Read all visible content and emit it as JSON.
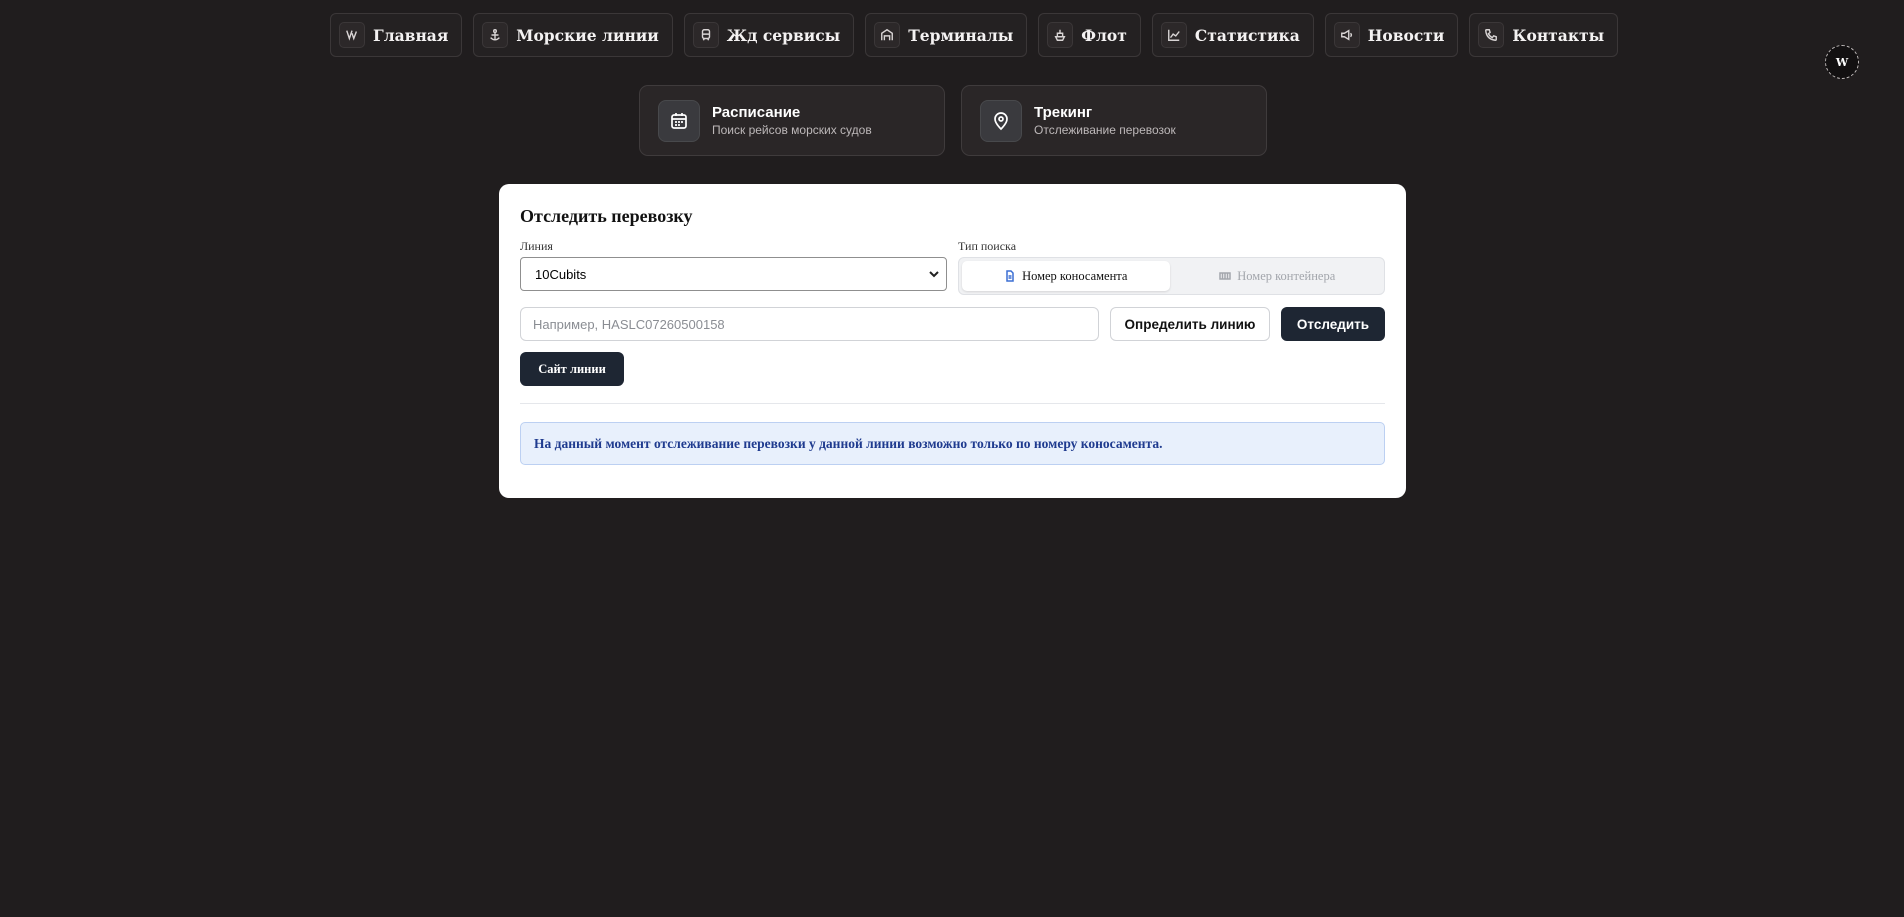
{
  "nav": {
    "items": [
      {
        "label": "Главная",
        "icon": "brand-logo-icon"
      },
      {
        "label": "Морские линии",
        "icon": "anchor-icon"
      },
      {
        "label": "Жд сервисы",
        "icon": "train-icon"
      },
      {
        "label": "Терминалы",
        "icon": "warehouse-icon"
      },
      {
        "label": "Флот",
        "icon": "ship-icon"
      },
      {
        "label": "Статистика",
        "icon": "line-chart-icon"
      },
      {
        "label": "Новости",
        "icon": "megaphone-icon"
      },
      {
        "label": "Контакты",
        "icon": "phone-icon"
      }
    ]
  },
  "tiles": [
    {
      "title": "Расписание",
      "subtitle": "Поиск рейсов морских судов",
      "icon": "calendar-icon"
    },
    {
      "title": "Трекинг",
      "subtitle": "Отслеживание перевозок",
      "icon": "map-pin-icon"
    }
  ],
  "tracking": {
    "title": "Отследить перевозку",
    "line_label": "Линия",
    "line_value": "10Cubits",
    "search_type_label": "Тип поиска",
    "search_type_options": [
      "Номер коносамента",
      "Номер контейнера"
    ],
    "search_type_selected": "Номер коносамента",
    "input_placeholder": "Например, HASLC07260500158",
    "detect_line_button": "Определить линию",
    "track_button": "Отследить",
    "site_button": "Сайт линии",
    "info_message": "На данный момент отслеживание перевозки у данной линии возможно только по номеру коносамента."
  },
  "colors": {
    "background": "#201d1e",
    "primary_button": "#1e2633",
    "info_bg": "#e8f0fc",
    "info_text": "#1f3b8f"
  }
}
